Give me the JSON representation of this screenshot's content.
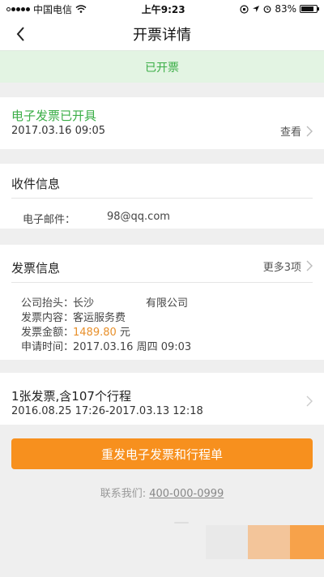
{
  "status_bar": {
    "carrier": "中国电信",
    "time": "上午9:23",
    "battery": "83%",
    "battery_level": 0.83
  },
  "nav": {
    "title": "开票详情"
  },
  "banner": {
    "status": "已开票"
  },
  "invoice_status": {
    "title": "电子发票已开具",
    "datetime": "2017.03.16 09:05",
    "view_label": "查看"
  },
  "recipient": {
    "title": "收件信息",
    "email_label": "电子邮件：",
    "email_value": "98@qq.com"
  },
  "invoice_info": {
    "title": "发票信息",
    "more_label": "更多3项",
    "company_label": "公司抬头：",
    "company_prefix": "长沙",
    "company_suffix": "有限公司",
    "content_label": "发票内容：",
    "content_value": "客运服务费",
    "amount_label": "发票金额：",
    "amount_value": "1489.80",
    "amount_unit": "元",
    "time_label": "申请时间：",
    "time_value": "2017.03.16 周四 09:03"
  },
  "trips": {
    "title": "1张发票,含107个行程",
    "range": "2016.08.25 17:26-2017.03.13 12:18"
  },
  "actions": {
    "resend_label": "重发电子发票和行程单"
  },
  "contact": {
    "label": "联系我们:",
    "phone": "400-000-0999"
  },
  "colors": {
    "green": "#3bae47",
    "orange": "#f7901e",
    "amount": "#e8902b"
  }
}
